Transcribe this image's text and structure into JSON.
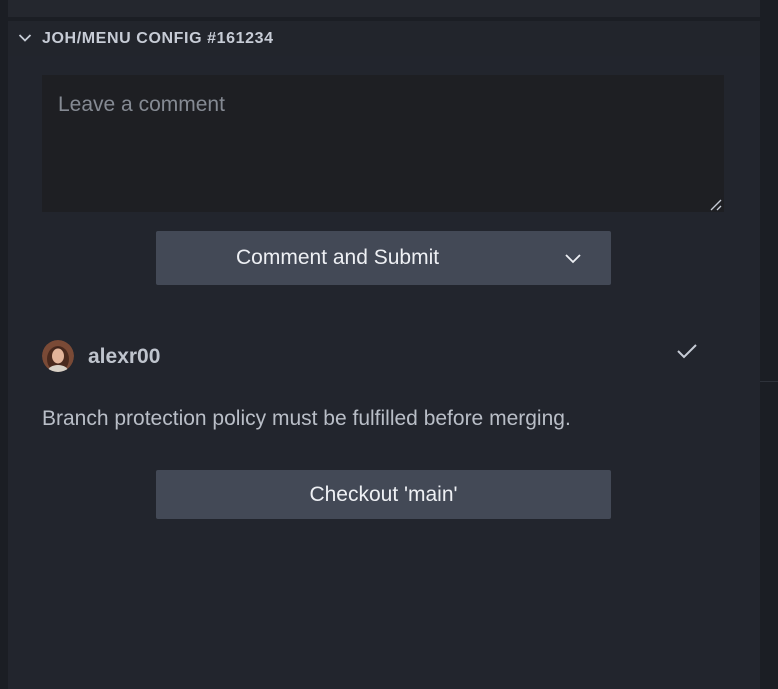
{
  "section": {
    "title": "JOH/MENU CONFIG #161234",
    "collapse_icon": "chevron-down-icon"
  },
  "comment": {
    "placeholder": "Leave a comment",
    "value": ""
  },
  "submit_button": {
    "label": "Comment and Submit",
    "dropdown_icon": "chevron-down-icon"
  },
  "review": {
    "username": "alexr00",
    "status_icon": "check-icon",
    "message": "Branch protection policy must be fulfilled before merging."
  },
  "checkout_button": {
    "label": "Checkout 'main'"
  },
  "colors": {
    "background": "#1b1e24",
    "panel": "#22252d",
    "button": "#434956",
    "text": "#b9bec7"
  }
}
